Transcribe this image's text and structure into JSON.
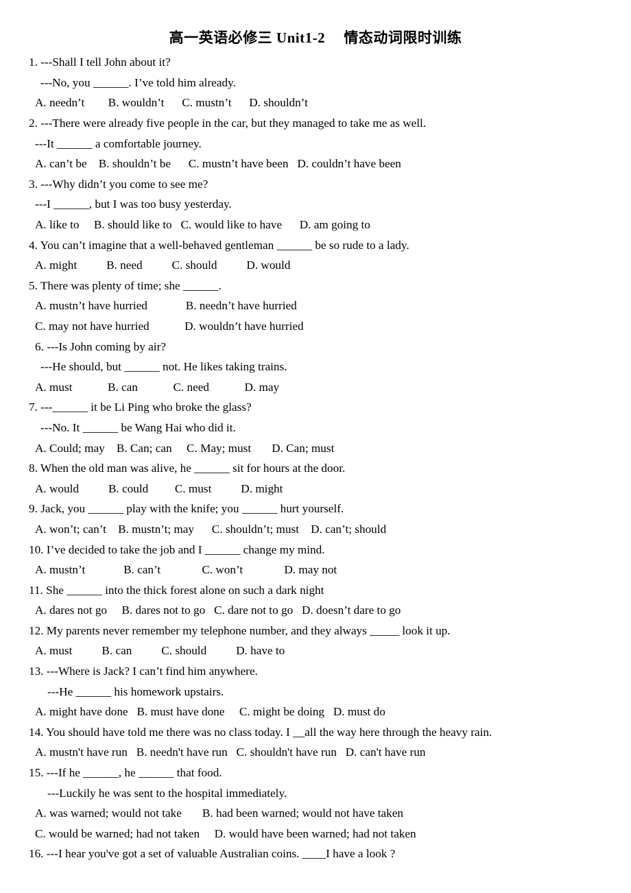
{
  "document": {
    "title": "高一英语必修三 Unit1-2　 情态动词限时训练",
    "page_background": "#ffffff",
    "text_color": "#000000"
  },
  "questions": [
    {
      "number": "1",
      "lines": [
        {
          "indent": 0,
          "text": "1. ---Shall I tell John about it?"
        },
        {
          "indent": 2,
          "text": "---No, you ______. I’ve told him already."
        },
        {
          "indent": 1,
          "text": "A. needn’t        B. wouldn’t      C. mustn’t      D. shouldn’t"
        }
      ]
    },
    {
      "number": "2",
      "lines": [
        {
          "indent": 0,
          "text": "2. ---There were already five people in the car, but they managed to take me as well."
        },
        {
          "indent": 1,
          "text": "---It ______ a comfortable journey."
        },
        {
          "indent": 1,
          "text": "A. can’t be    B. shouldn’t be      C. mustn’t have been   D. couldn’t have been"
        }
      ]
    },
    {
      "number": "3",
      "lines": [
        {
          "indent": 0,
          "text": "3. ---Why didn’t you come to see me?"
        },
        {
          "indent": 1,
          "text": "---I ______, but I was too busy yesterday."
        },
        {
          "indent": 1,
          "text": "A. like to     B. should like to   C. would like to have      D. am going to"
        }
      ]
    },
    {
      "number": "4",
      "lines": [
        {
          "indent": 0,
          "text": "4. You can’t imagine that a well-behaved gentleman ______ be so rude to a lady."
        },
        {
          "indent": 1,
          "text": "A. might          B. need          C. should          D. would"
        }
      ]
    },
    {
      "number": "5",
      "lines": [
        {
          "indent": 0,
          "text": "5. There was plenty of time; she ______."
        },
        {
          "indent": 1,
          "text": "A. mustn’t have hurried             B. needn’t have hurried"
        },
        {
          "indent": 1,
          "text": "C. may not have hurried            D. wouldn’t have hurried"
        }
      ]
    },
    {
      "number": "6",
      "lines": [
        {
          "indent": 1,
          "text": "6. ---Is John coming by air?"
        },
        {
          "indent": 2,
          "text": "---He should, but ______ not. He likes taking trains."
        },
        {
          "indent": 1,
          "text": "A. must            B. can            C. need            D. may"
        }
      ]
    },
    {
      "number": "7",
      "lines": [
        {
          "indent": 0,
          "text": "7. ---______ it be Li Ping who broke the glass?"
        },
        {
          "indent": 2,
          "text": "---No. It ______ be Wang Hai who did it."
        },
        {
          "indent": 1,
          "text": "A. Could; may    B. Can; can     C. May; must       D. Can; must"
        }
      ]
    },
    {
      "number": "8",
      "lines": [
        {
          "indent": 0,
          "text": "8. When the old man was alive, he ______ sit for hours at the door."
        },
        {
          "indent": 1,
          "text": "A. would          B. could         C. must          D. might"
        }
      ]
    },
    {
      "number": "9",
      "lines": [
        {
          "indent": 0,
          "text": "9. Jack, you ______ play with the knife; you ______ hurt yourself."
        },
        {
          "indent": 1,
          "text": "A. won’t; can’t    B. mustn’t; may      C. shouldn’t; must    D. can’t; should"
        }
      ]
    },
    {
      "number": "10",
      "lines": [
        {
          "indent": 0,
          "text": "10. I’ve decided to take the job and I ______ change my mind."
        },
        {
          "indent": 1,
          "text": "A. mustn’t             B. can’t              C. won’t              D. may not"
        }
      ]
    },
    {
      "number": "11",
      "lines": [
        {
          "indent": 0,
          "text": "11. She ______ into the thick forest alone on such a dark night"
        },
        {
          "indent": 1,
          "text": "A. dares not go     B. dares not to go   C. dare not to go   D. doesn’t dare to go"
        }
      ]
    },
    {
      "number": "12",
      "lines": [
        {
          "indent": 0,
          "text": "12. My parents never remember my telephone number, and they always _____ look it up."
        },
        {
          "indent": 1,
          "text": "A. must          B. can          C. should          D. have to"
        }
      ]
    },
    {
      "number": "13",
      "lines": [
        {
          "indent": 0,
          "text": "13. ---Where is Jack? I can’t find him anywhere."
        },
        {
          "indent": 3,
          "text": "---He ______ his homework upstairs."
        },
        {
          "indent": 1,
          "text": "A. might have done   B. must have done     C. might be doing   D. must do"
        }
      ]
    },
    {
      "number": "14",
      "lines": [
        {
          "indent": 0,
          "text": "14. You should have told me there was no class today. I __all the way here through the heavy rain."
        },
        {
          "indent": 1,
          "text": "A. mustn't have run   B. needn't have run   C. shouldn't have run   D. can't have run"
        }
      ]
    },
    {
      "number": "15",
      "lines": [
        {
          "indent": 0,
          "text": "15. ---If he ______, he ______ that food."
        },
        {
          "indent": 3,
          "text": "---Luckily he was sent to the hospital immediately."
        },
        {
          "indent": 1,
          "text": "A. was warned; would not take       B. had been warned; would not have taken"
        },
        {
          "indent": 1,
          "text": "C. would be warned; had not taken     D. would have been warned; had not taken"
        }
      ]
    },
    {
      "number": "16",
      "lines": [
        {
          "indent": 0,
          "text": "16. ---I hear you've got a set of valuable Australian coins. ____I have a look ?"
        }
      ]
    }
  ]
}
